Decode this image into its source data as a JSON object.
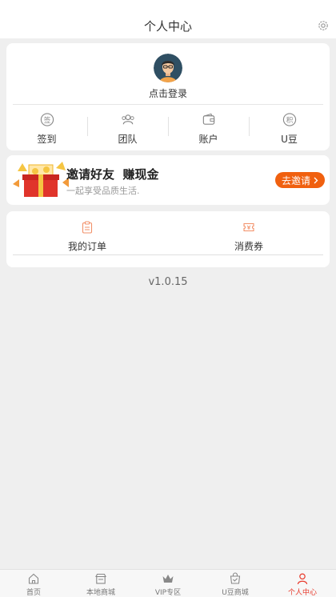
{
  "header": {
    "title": "个人中心",
    "settings_icon": "gear-icon"
  },
  "profile": {
    "avatar_icon": "avatar-icon",
    "login_label": "点击登录",
    "quick_links": [
      {
        "label": "签到",
        "icon": "sign-in-icon"
      },
      {
        "label": "团队",
        "icon": "team-icon"
      },
      {
        "label": "账户",
        "icon": "wallet-icon"
      },
      {
        "label": "U豆",
        "icon": "points-icon"
      }
    ]
  },
  "invite": {
    "title": "邀请好友  赚现金",
    "subtitle": "一起享受品质生活.",
    "button_label": "去邀请",
    "button_color": "#f0600f"
  },
  "orders": {
    "items": [
      {
        "label": "我的订单",
        "icon": "clipboard-icon"
      },
      {
        "label": "消费券",
        "icon": "coupon-icon"
      }
    ]
  },
  "version": "v1.0.15",
  "tabbar": {
    "accent": "#e8392b",
    "tabs": [
      {
        "label": "首页",
        "icon": "home-icon"
      },
      {
        "label": "本地商城",
        "icon": "store-icon"
      },
      {
        "label": "VIP专区",
        "icon": "crown-icon"
      },
      {
        "label": "U豆商城",
        "icon": "bag-icon"
      },
      {
        "label": "个人中心",
        "icon": "user-icon",
        "active": true
      }
    ]
  }
}
